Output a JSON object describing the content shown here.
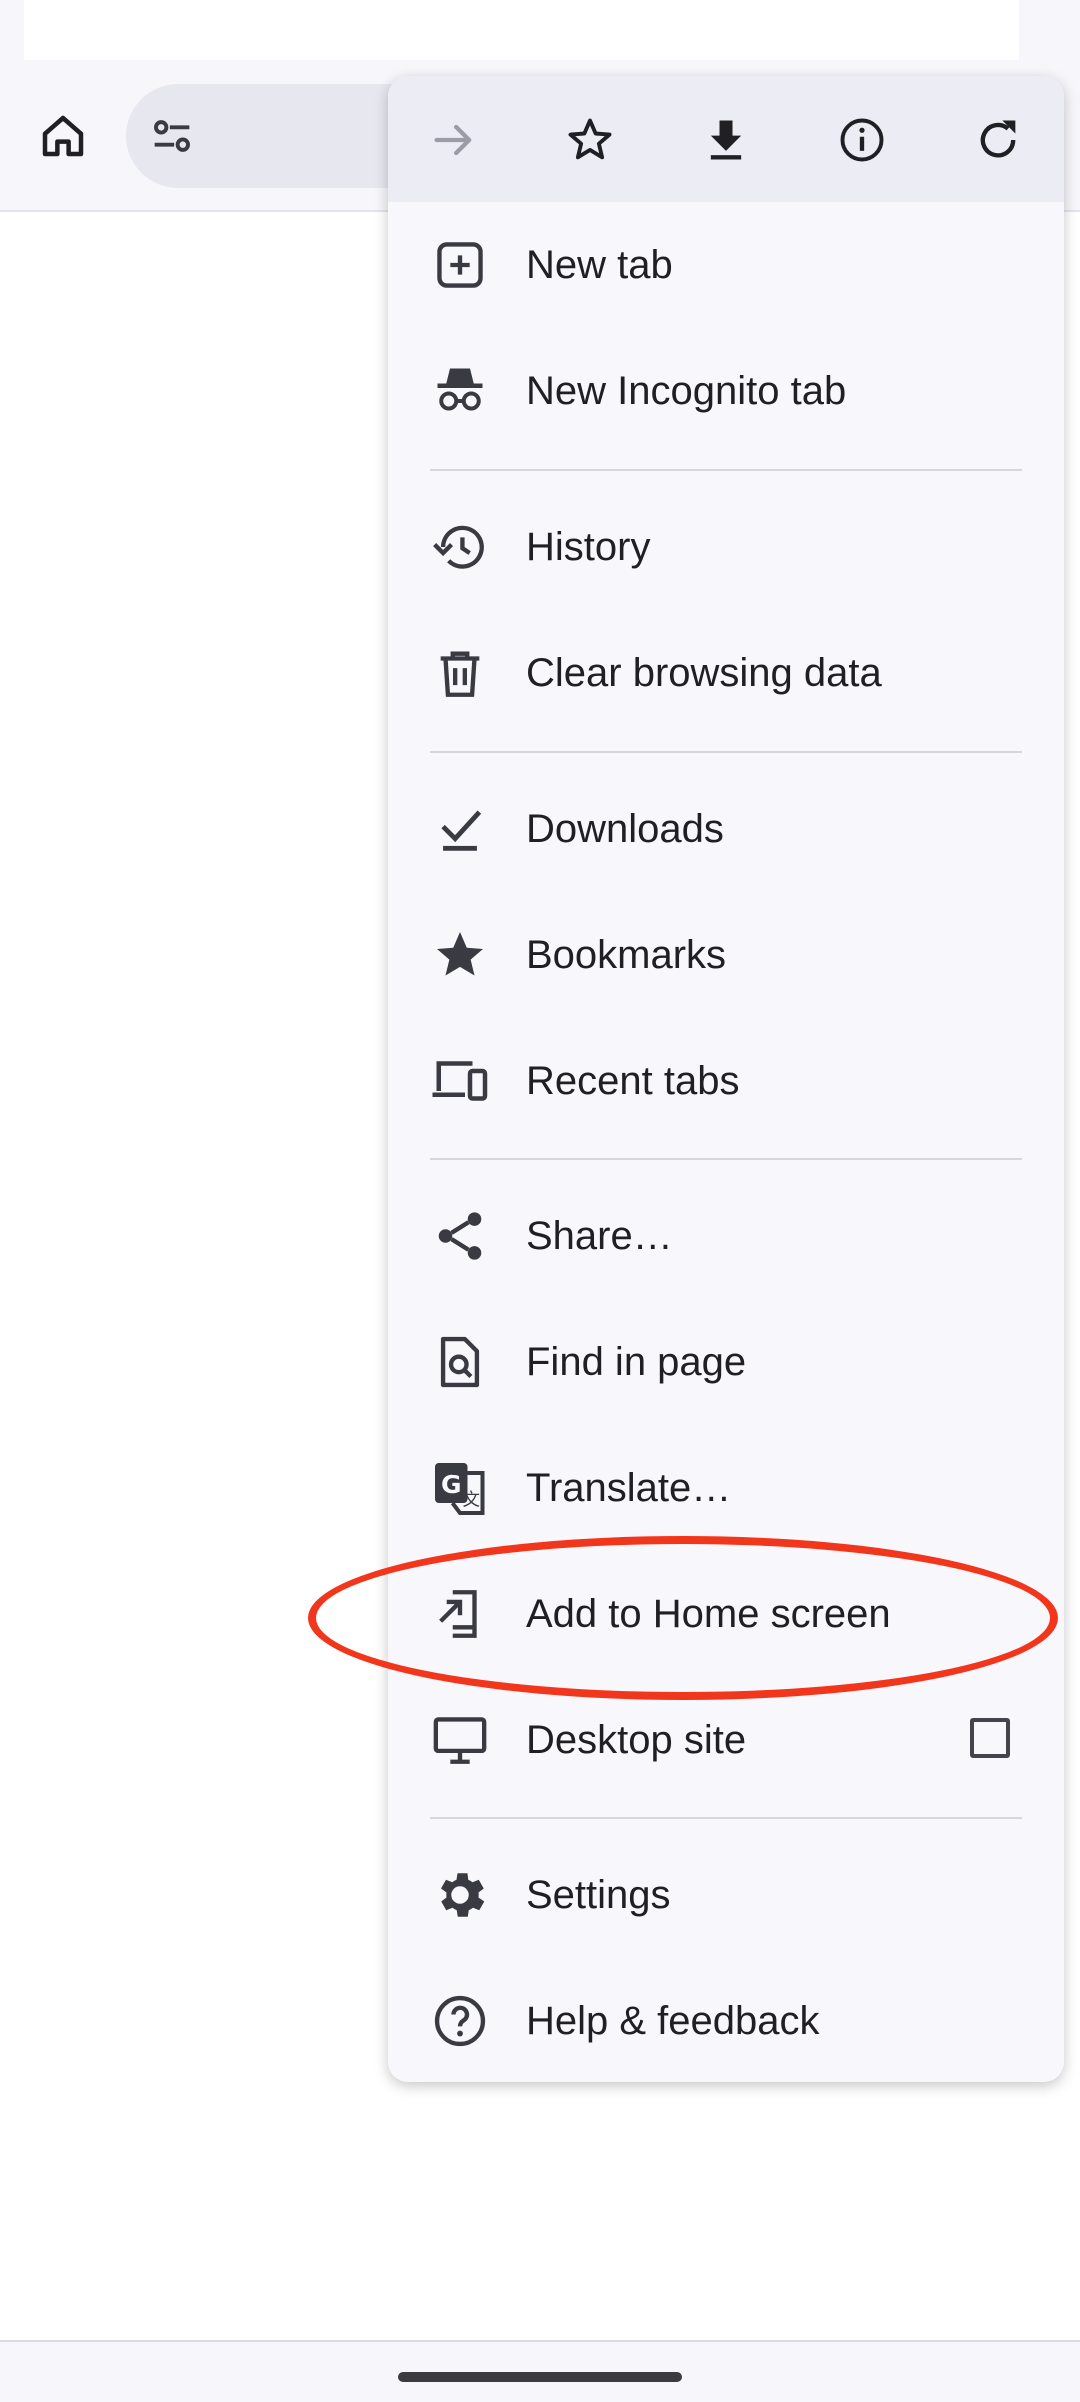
{
  "toolbar": {
    "home_icon": "home-icon",
    "site_settings_icon": "tune-icon"
  },
  "menu": {
    "top_icons": [
      "forward-arrow-icon",
      "star-outline-icon",
      "download-icon",
      "info-icon",
      "refresh-icon"
    ],
    "items": [
      {
        "label": "New tab",
        "icon": "plus-box-icon"
      },
      {
        "label": "New Incognito tab",
        "icon": "incognito-icon"
      },
      {
        "label": "History",
        "icon": "history-icon"
      },
      {
        "label": "Clear browsing data",
        "icon": "trash-icon"
      },
      {
        "label": "Downloads",
        "icon": "download-done-icon"
      },
      {
        "label": "Bookmarks",
        "icon": "star-filled-icon"
      },
      {
        "label": "Recent tabs",
        "icon": "devices-icon"
      },
      {
        "label": "Share…",
        "icon": "share-icon"
      },
      {
        "label": "Find in page",
        "icon": "find-in-page-icon"
      },
      {
        "label": "Translate…",
        "icon": "translate-icon"
      },
      {
        "label": "Add to Home screen",
        "icon": "add-to-home-icon"
      },
      {
        "label": "Desktop site",
        "icon": "desktop-icon",
        "checked": false
      },
      {
        "label": "Settings",
        "icon": "gear-icon"
      },
      {
        "label": "Help & feedback",
        "icon": "help-icon"
      }
    ]
  },
  "highlight": {
    "target": "Add to Home screen",
    "color": "#f2361c"
  },
  "colors": {
    "menu_bg": "#f7f7fc",
    "icon_row_bg": "#ececf4",
    "text": "#1f1f24"
  }
}
